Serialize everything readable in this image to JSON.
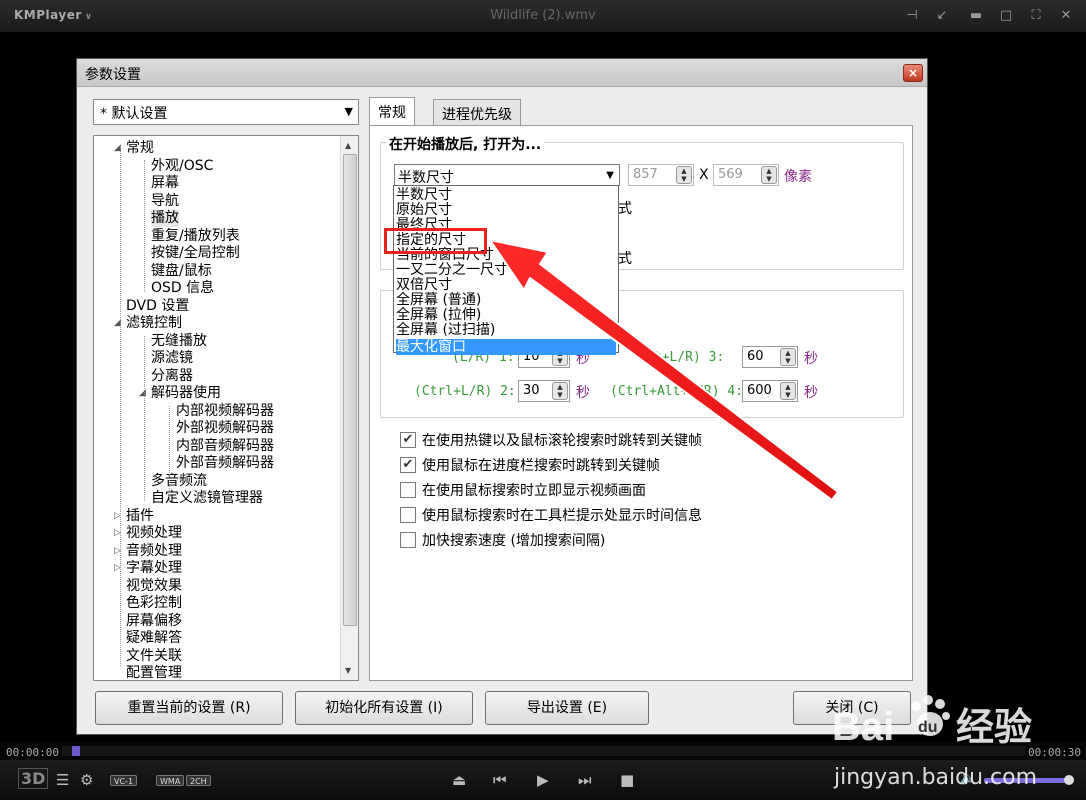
{
  "player": {
    "logo": "KMPlayer",
    "file_title": "Wildlife (2).wmv",
    "time_current": "00:00:00",
    "time_total": "00:00:30",
    "seek_progress": 0.01,
    "badges": [
      "VC-1",
      "WMA",
      "2CH"
    ],
    "mode_label": "3D"
  },
  "dialog": {
    "title": "参数设置",
    "close": "×",
    "profile": "* 默认设置",
    "tabs": [
      "常规",
      "进程优先级"
    ],
    "tree": [
      {
        "label": "常规",
        "exp": "◢"
      },
      {
        "label": "外观/OSC"
      },
      {
        "label": "屏幕"
      },
      {
        "label": "导航"
      },
      {
        "label": "播放"
      },
      {
        "label": "重复/播放列表"
      },
      {
        "label": "按键/全局控制"
      },
      {
        "label": "键盘/鼠标"
      },
      {
        "label": "OSD 信息"
      },
      {
        "label": "DVD 设置"
      },
      {
        "label": "滤镜控制",
        "exp": "◢"
      },
      {
        "label": "无缝播放"
      },
      {
        "label": "源滤镜"
      },
      {
        "label": "分离器"
      },
      {
        "label": "解码器使用",
        "exp": "◢"
      },
      {
        "label": "内部视频解码器"
      },
      {
        "label": "外部视频解码器"
      },
      {
        "label": "内部音频解码器"
      },
      {
        "label": "外部音频解码器"
      },
      {
        "label": "多音频流"
      },
      {
        "label": "自定义滤镜管理器"
      },
      {
        "label": "插件",
        "exp": "▷"
      },
      {
        "label": "视频处理",
        "exp": "▷"
      },
      {
        "label": "音频处理",
        "exp": "▷"
      },
      {
        "label": "字幕处理",
        "exp": "▷"
      },
      {
        "label": "视觉效果"
      },
      {
        "label": "色彩控制"
      },
      {
        "label": "屏幕偏移"
      },
      {
        "label": "疑难解答"
      },
      {
        "label": "文件关联"
      },
      {
        "label": "配置管理"
      }
    ],
    "general": {
      "open_group_label": "在开始播放后, 打开为...",
      "size_selected": "半数尺寸",
      "width": "857",
      "x_label": "X",
      "height": "569",
      "unit": "像素",
      "partial_1": "式",
      "partial_2": "式",
      "size_options": [
        "半数尺寸",
        "原始尺寸",
        "最终尺寸",
        "指定的尺寸",
        "当前的窗口尺寸",
        "一又二分之一尺寸",
        "双倍尺寸",
        "全屏幕 (普通)",
        "全屏幕 (拉伸)",
        "全屏幕 (过扫描)",
        "最大化窗口"
      ],
      "highlight_selected": "最大化窗口",
      "seek_rows": [
        {
          "left_label": "(L/R) 1:",
          "left_value": "10",
          "left_unit": "秒",
          "right_label": "lt+L/R) 3:",
          "right_value": "60",
          "right_unit": "秒"
        },
        {
          "left_label": "(Ctrl+L/R) 2:",
          "left_value": "30",
          "left_unit": "秒",
          "right_label": "(Ctrl+Alt+L/R) 4:",
          "right_value": "600",
          "right_unit": "秒"
        }
      ],
      "checkboxes": [
        {
          "label": "在使用热键以及鼠标滚轮搜索时跳转到关键帧",
          "checked": true
        },
        {
          "label": "使用鼠标在进度栏搜索时跳转到关键帧",
          "checked": true
        },
        {
          "label": "在使用鼠标搜索时立即显示视频画面",
          "checked": false
        },
        {
          "label": "使用鼠标搜索时在工具栏提示处显示时间信息",
          "checked": false
        },
        {
          "label": "加快搜索速度 (增加搜索间隔)",
          "checked": false
        }
      ]
    },
    "buttons": {
      "reset_current": "重置当前的设置 (R)",
      "init_all": "初始化所有设置 (I)",
      "export": "导出设置 (E)",
      "close": "关闭 (C)"
    }
  },
  "watermark": {
    "brand": "Bai",
    "brand2": "du",
    "suffix": "经验",
    "url": "jingyan.baidu.com"
  },
  "colors": {
    "highlight_box": "#e8231f",
    "arrow": "#e8231f",
    "dropdown_selected": "#3399ff",
    "seek_label": "#3b9c3b",
    "unit_purple": "#8a2b8a"
  }
}
